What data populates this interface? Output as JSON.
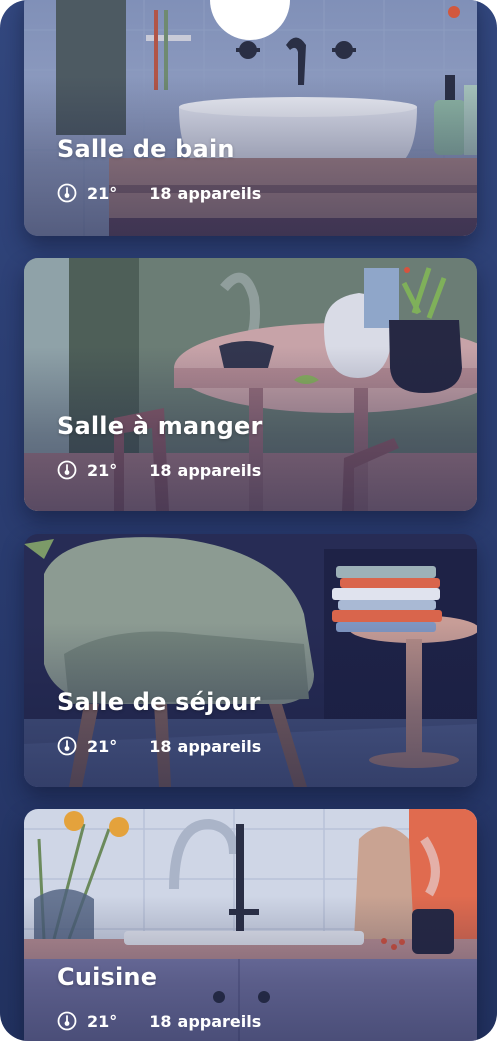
{
  "rooms": [
    {
      "title": "Salle de bain",
      "temperature": "21°",
      "devices_count": "18",
      "devices_label": "appareils",
      "icon": "thermometer-icon"
    },
    {
      "title": "Salle à manger",
      "temperature": "21°",
      "devices_count": "18",
      "devices_label": "appareils",
      "icon": "thermometer-icon"
    },
    {
      "title": "Salle de séjour",
      "temperature": "21°",
      "devices_count": "18",
      "devices_label": "appareils",
      "icon": "thermometer-icon"
    },
    {
      "title": "Cuisine",
      "temperature": "21°",
      "devices_count": "18",
      "devices_label": "appareils",
      "icon": "thermometer-icon"
    }
  ]
}
